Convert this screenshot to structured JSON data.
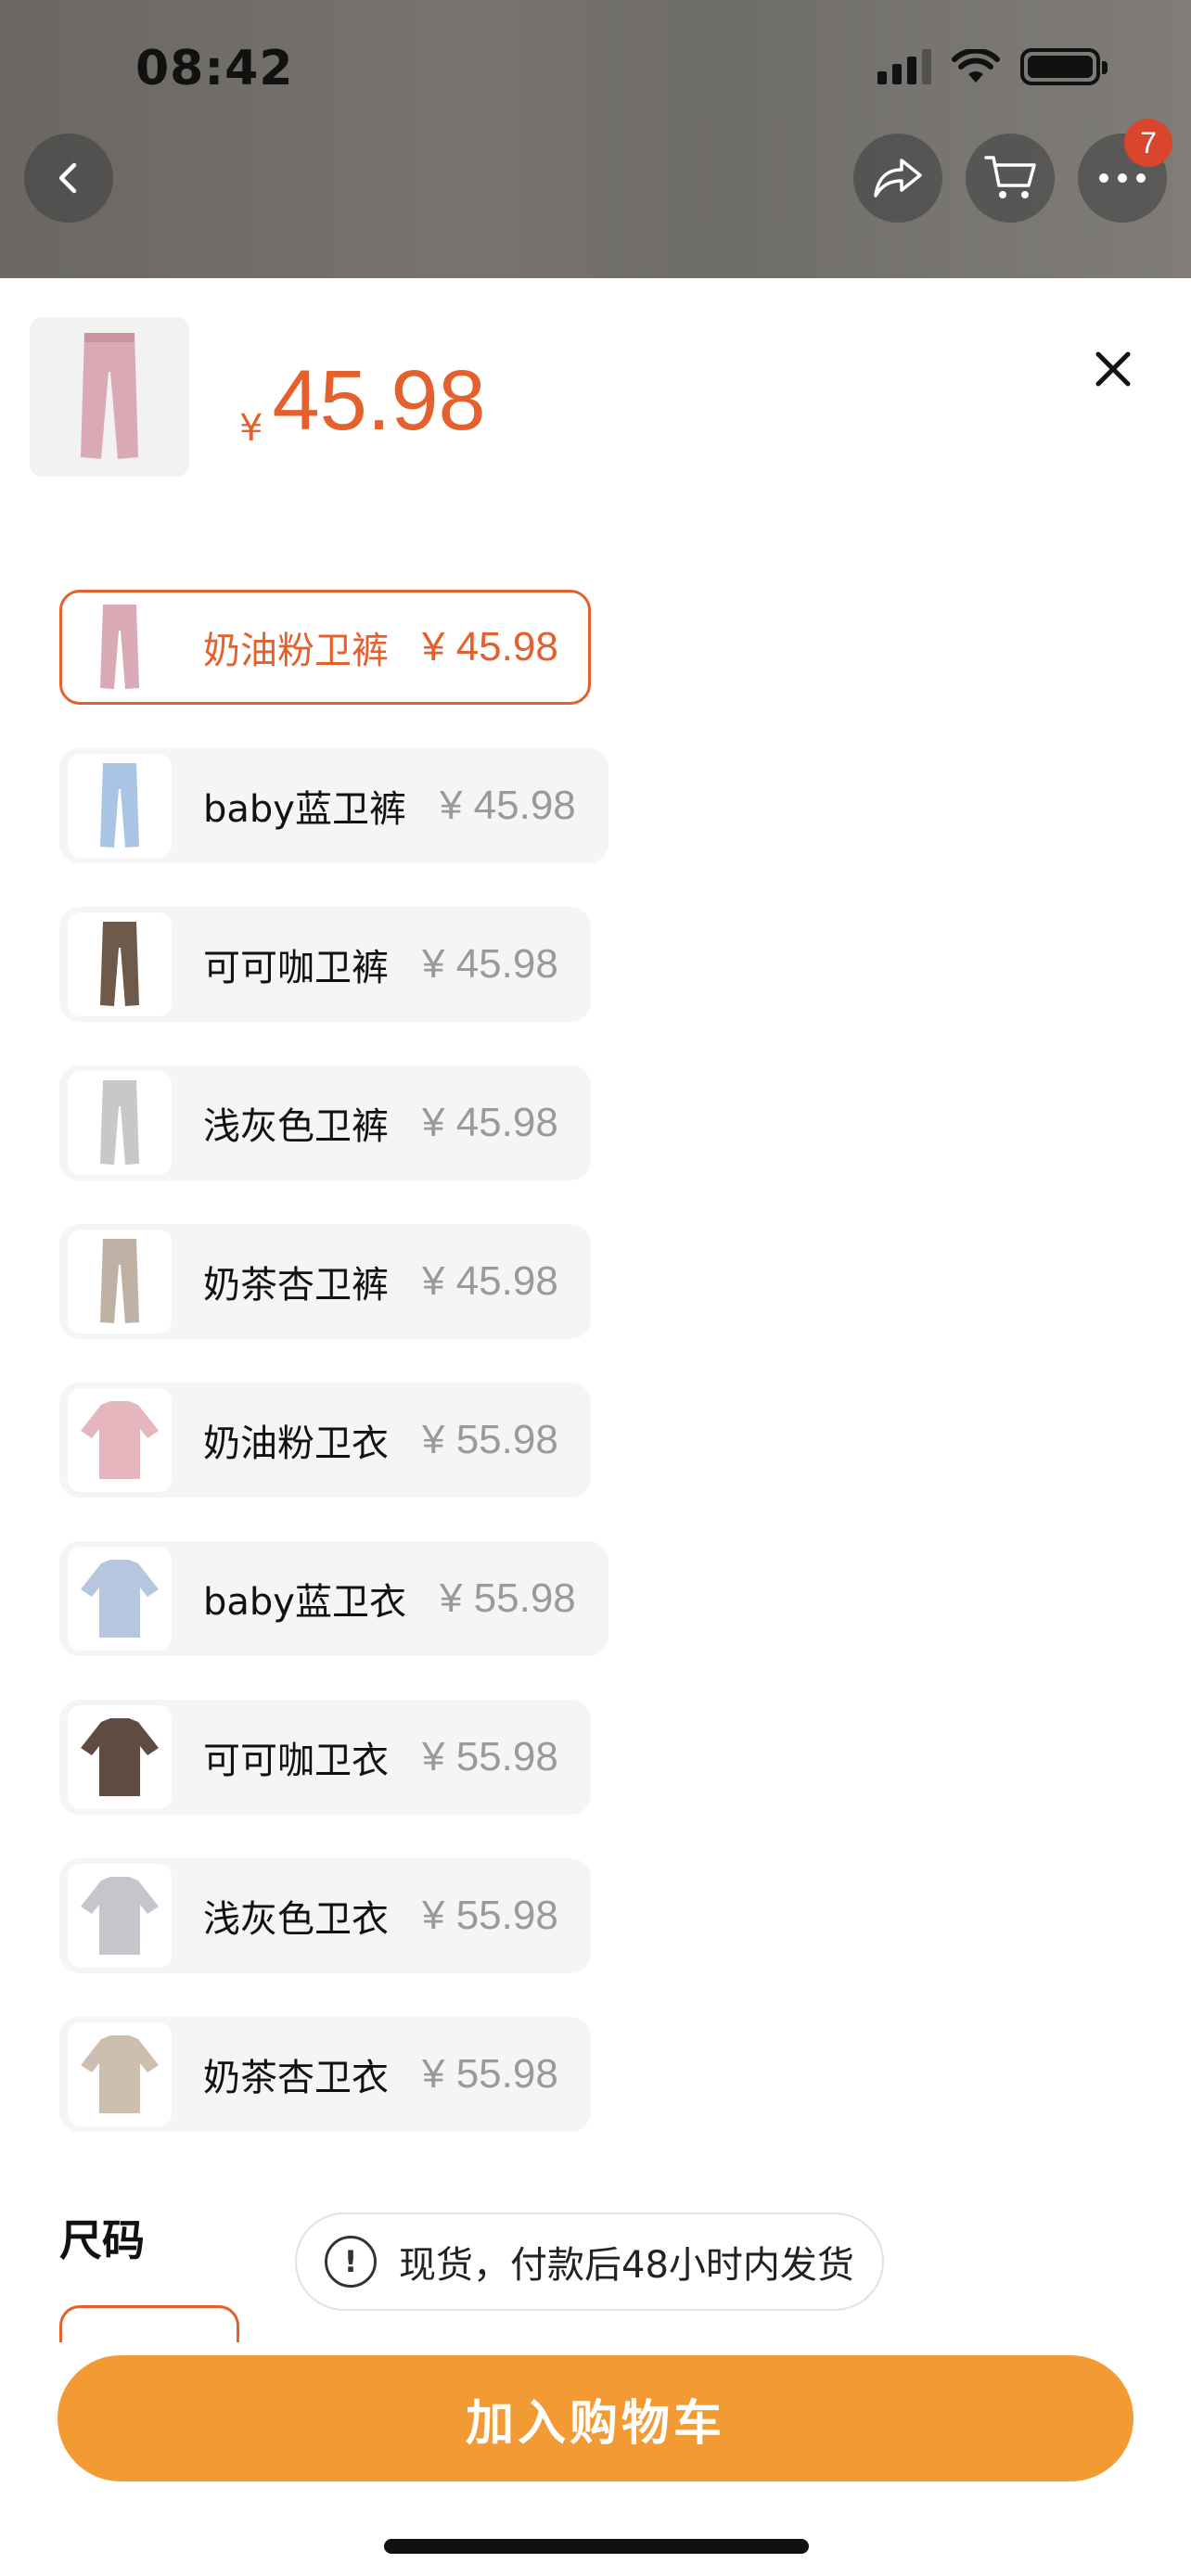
{
  "status_bar": {
    "time": "08:42"
  },
  "top_bar": {
    "cart_badge_count": "7"
  },
  "header": {
    "currency": "¥",
    "price": "45.98"
  },
  "variants": [
    {
      "name": "奶油粉卫裤",
      "price": "¥ 45.98",
      "selected": true,
      "thumb_color": "#d9a9b6"
    },
    {
      "name": "baby蓝卫裤",
      "price": "¥ 45.98",
      "selected": false,
      "thumb_color": "#aac4e6"
    },
    {
      "name": "可可咖卫裤",
      "price": "¥ 45.98",
      "selected": false,
      "thumb_color": "#6e5a4a"
    },
    {
      "name": "浅灰色卫裤",
      "price": "¥ 45.98",
      "selected": false,
      "thumb_color": "#c8c8c8"
    },
    {
      "name": "奶茶杏卫裤",
      "price": "¥ 45.98",
      "selected": false,
      "thumb_color": "#bfb1a4"
    },
    {
      "name": "奶油粉卫衣",
      "price": "¥ 55.98",
      "selected": false,
      "thumb_color": "#e6b6bf"
    },
    {
      "name": "baby蓝卫衣",
      "price": "¥ 55.98",
      "selected": false,
      "thumb_color": "#b6c6de"
    },
    {
      "name": "可可咖卫衣",
      "price": "¥ 55.98",
      "selected": false,
      "thumb_color": "#5f4b40"
    },
    {
      "name": "浅灰色卫衣",
      "price": "¥ 55.98",
      "selected": false,
      "thumb_color": "#c4c6cc"
    },
    {
      "name": "奶茶杏卫衣",
      "price": "¥ 55.98",
      "selected": false,
      "thumb_color": "#cdbfb0"
    }
  ],
  "size_section": {
    "label": "尺码"
  },
  "stock_tip": {
    "icon": "!",
    "text": "现货，付款后48小时内发货"
  },
  "footer": {
    "add_to_cart_label": "加入购物车"
  },
  "colors": {
    "accent": "#e4602c",
    "cart_button": "#f29a33"
  }
}
